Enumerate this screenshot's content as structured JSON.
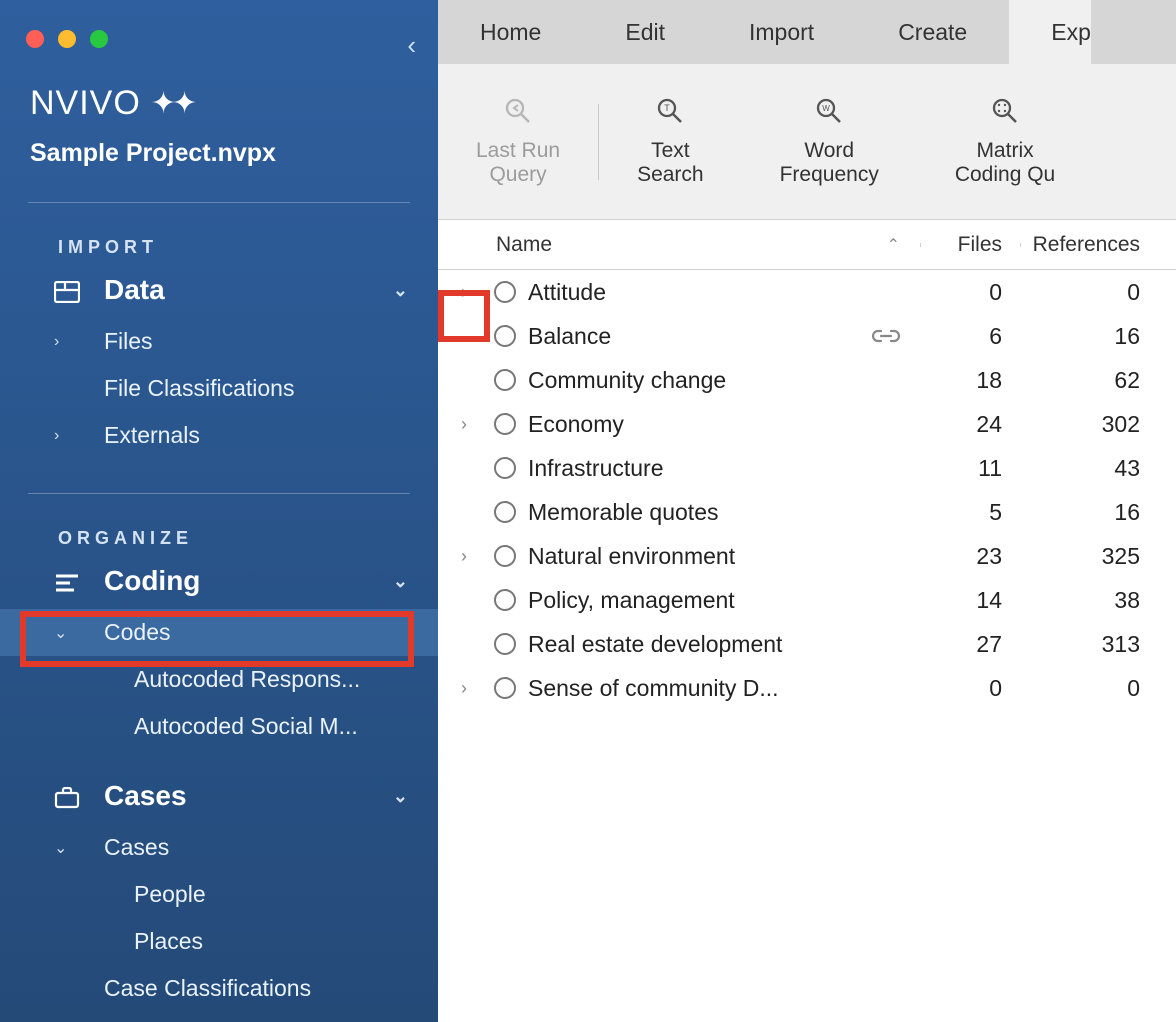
{
  "app": {
    "logo_text": "NVIVO",
    "project_name": "Sample Project.nvpx"
  },
  "sidebar": {
    "sections": {
      "import": {
        "label": "IMPORT",
        "group": {
          "label": "Data"
        },
        "items": [
          {
            "label": "Files",
            "has_children": true
          },
          {
            "label": "File Classifications",
            "has_children": false
          },
          {
            "label": "Externals",
            "has_children": true
          }
        ]
      },
      "organize": {
        "label": "ORGANIZE",
        "coding": {
          "label": "Coding",
          "items": [
            {
              "label": "Codes",
              "selected": true
            },
            {
              "label": "Autocoded Respons...",
              "indent": 2
            },
            {
              "label": "Autocoded Social M...",
              "indent": 2
            }
          ]
        },
        "cases": {
          "label": "Cases",
          "items": [
            {
              "label": "Cases"
            },
            {
              "label": "People",
              "indent": 2
            },
            {
              "label": "Places",
              "indent": 2
            },
            {
              "label": "Case Classifications"
            }
          ]
        }
      }
    }
  },
  "tabs": [
    {
      "label": "Home"
    },
    {
      "label": "Edit"
    },
    {
      "label": "Import"
    },
    {
      "label": "Create"
    },
    {
      "label": "Exp",
      "active": true,
      "cut": true
    }
  ],
  "toolbar": {
    "last_run": {
      "line1": "Last Run",
      "line2": "Query"
    },
    "text_search": {
      "line1": "Text",
      "line2": "Search"
    },
    "word_freq": {
      "line1": "Word",
      "line2": "Frequency"
    },
    "matrix": {
      "line1": "Matrix",
      "line2": "Coding Qu"
    }
  },
  "table": {
    "columns": {
      "name": "Name",
      "files": "Files",
      "refs": "References"
    },
    "rows": [
      {
        "name": "Attitude",
        "files": 0,
        "refs": 0,
        "expandable": true,
        "highlight": true
      },
      {
        "name": "Balance",
        "files": 6,
        "refs": 16,
        "link": true
      },
      {
        "name": "Community change",
        "files": 18,
        "refs": 62
      },
      {
        "name": "Economy",
        "files": 24,
        "refs": 302,
        "expandable": true
      },
      {
        "name": "Infrastructure",
        "files": 11,
        "refs": 43
      },
      {
        "name": "Memorable quotes",
        "files": 5,
        "refs": 16
      },
      {
        "name": "Natural environment",
        "files": 23,
        "refs": 325,
        "expandable": true
      },
      {
        "name": "Policy, management",
        "files": 14,
        "refs": 38
      },
      {
        "name": "Real estate development",
        "files": 27,
        "refs": 313
      },
      {
        "name": "Sense of community D...",
        "files": 0,
        "refs": 0,
        "expandable": true
      }
    ]
  }
}
